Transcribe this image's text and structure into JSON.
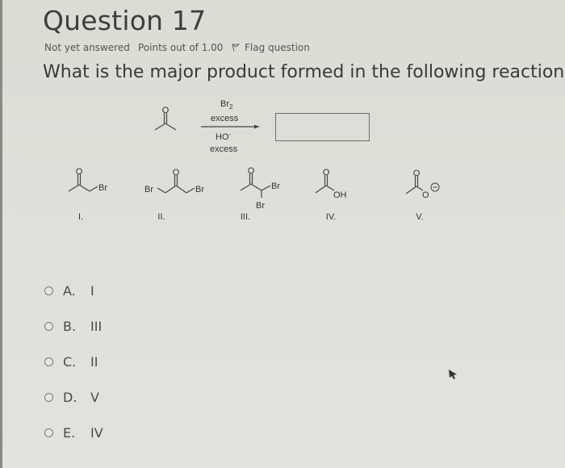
{
  "question": {
    "title": "Question 17",
    "status": "Not yet answered",
    "points": "Points out of 1.00",
    "flag_label": "Flag question",
    "flag_icon": "flag-icon",
    "text": "What is the major product formed in the following reaction?"
  },
  "reaction": {
    "reactant": "acetone",
    "reagent_top_1": "Br",
    "reagent_top_1_sub": "2",
    "reagent_top_2": "excess",
    "reagent_bottom_1": "HO",
    "reagent_bottom_1_sup": "-",
    "reagent_bottom_2": "excess",
    "product_box": "empty answer box"
  },
  "structures": [
    {
      "label": "I.",
      "atoms": [
        "O",
        "Br"
      ]
    },
    {
      "label": "II.",
      "atoms": [
        "O",
        "Br",
        "Br"
      ]
    },
    {
      "label": "III.",
      "atoms": [
        "O",
        "Br",
        "Br"
      ]
    },
    {
      "label": "IV.",
      "atoms": [
        "O",
        "OH"
      ]
    },
    {
      "label": "V.",
      "atoms": [
        "O",
        "O",
        "⊖"
      ]
    }
  ],
  "options": [
    {
      "letter": "A.",
      "value": "I"
    },
    {
      "letter": "B.",
      "value": "III"
    },
    {
      "letter": "C.",
      "value": "II"
    },
    {
      "letter": "D.",
      "value": "V"
    },
    {
      "letter": "E.",
      "value": "IV"
    }
  ]
}
